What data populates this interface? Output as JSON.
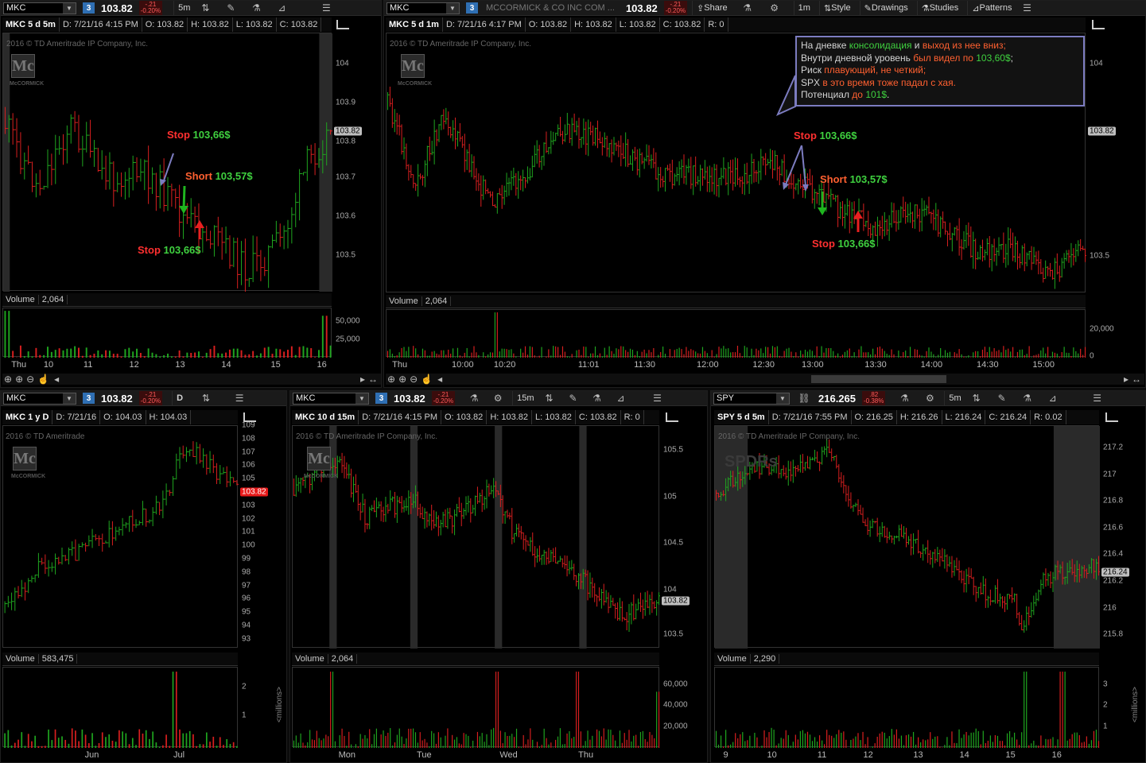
{
  "colors": {
    "up": "#1fa51f",
    "down": "#d81f1f",
    "bg": "#000000",
    "link": "#2f6fb3"
  },
  "icons": [
    "layout-icon",
    "drawings-icon",
    "studies-icon",
    "patterns-icon",
    "gear-icon",
    "style-icon",
    "share-icon",
    "menu-icon",
    "crosshair-icon",
    "zoom-in-icon",
    "zoom-out-icon",
    "zoom-icon",
    "hand-icon",
    "scroll-left-icon",
    "scroll-right-icon",
    "study-icon"
  ],
  "p1": {
    "symbol": "MKC",
    "link": "3",
    "last": "103.82",
    "chg1": "-.21",
    "chg2": "-0.20%",
    "interval": "5m",
    "title": "MKC 5 d 5m",
    "d": "D: 7/21/16 4:15 PM",
    "o": "O: 103.82",
    "h": "H: 103.82",
    "l": "L: 103.82",
    "c": "C: 103.82",
    "copyright": "2016 © TD Ameritrade IP Company, Inc.",
    "logo": "Mc",
    "logotext": "McCORMICK",
    "yticks": [
      "104",
      "103.9",
      "103.8",
      "103.7",
      "103.6",
      "103.5"
    ],
    "price_tag": "103.82",
    "vol_label": "Volume",
    "vol_val": "2,064",
    "vticks": [
      "50,000",
      "25,000"
    ],
    "xticks": [
      "Thu",
      "10",
      "11",
      "12",
      "13",
      "14",
      "15",
      "16"
    ],
    "annotations": {
      "stop1": "Stop",
      "stop1v": "103,66$",
      "short": "Short",
      "shortv": "103,57$",
      "stop2": "Stop",
      "stop2v": "103,66$"
    }
  },
  "p2": {
    "symbol": "MKC",
    "link": "3",
    "company": "MCCORMICK & CO INC COM ...",
    "last": "103.82",
    "chg1": "-.21",
    "chg2": "-0.20%",
    "share": "Share",
    "interval": "1m",
    "style": "Style",
    "drawings": "Drawings",
    "studies": "Studies",
    "patterns": "Patterns",
    "title": "MKC 5 d 1m",
    "d": "D: 7/21/16 4:17 PM",
    "o": "O: 103.82",
    "h": "H: 103.82",
    "l": "L: 103.82",
    "c": "C: 103.82",
    "r": "R: 0",
    "copyright": "2016 © TD Ameritrade IP Company, Inc.",
    "logo": "Mc",
    "logotext": "McCORMICK",
    "yticks": [
      "104",
      "103.5"
    ],
    "price_tag": "103.82",
    "vol_label": "Volume",
    "vol_val": "2,064",
    "vticks": [
      "20,000",
      "0"
    ],
    "xticks": [
      "Thu",
      "10:00",
      "10:20",
      "11:01",
      "11:30",
      "12:00",
      "12:30",
      "13:00",
      "13:30",
      "14:00",
      "14:30",
      "15:00"
    ],
    "annotations": {
      "stop1": "Stop",
      "stop1v": "103,66$",
      "short": "Short",
      "shortv": "103,57$",
      "stop2": "Stop",
      "stop2v": "103,66$"
    },
    "note": {
      "l1a": "На дневке ",
      "l1b": "консолидация",
      "l1c": " и ",
      "l1d": "выход из нее вниз;",
      "l2a": "Внутри дневной уровень ",
      "l2b": "был видел по ",
      "l2c": "103,60$",
      ";": ";",
      "l3a": "Риск ",
      "l3b": "плавующий, не четкий;",
      "l4a": "SPX ",
      "l4b": "в это время тоже падал с хая.",
      "l5a": "Потенциал ",
      "l5b": "до ",
      "l5c": "101$",
      "l5d": "."
    }
  },
  "p3": {
    "symbol": "MKC",
    "link": "3",
    "last": "103.82",
    "chg1": "-.21",
    "chg2": "-0.20%",
    "interval": "D",
    "title": "MKC 1 y D",
    "d": "D: 7/21/16",
    "o": "O: 104.03",
    "h": "H: 104.03",
    "copyright": "2016 © TD Ameritrade",
    "logo": "Mc",
    "logotext": "McCORMICK",
    "yticks": [
      "109",
      "108",
      "107",
      "106",
      "105",
      "104",
      "103",
      "102",
      "101",
      "100",
      "99",
      "98",
      "97",
      "96",
      "95",
      "94",
      "93"
    ],
    "price_tag": "103.82",
    "vol_label": "Volume",
    "vol_val": "583,475",
    "vticks": [
      "2",
      "1"
    ],
    "vunit": "<millions>",
    "xticks": [
      "Jun",
      "Jul"
    ]
  },
  "p4": {
    "symbol": "MKC",
    "link": "3",
    "last": "103.82",
    "chg1": "-.21",
    "chg2": "-0.20%",
    "interval": "15m",
    "title": "MKC 10 d 15m",
    "d": "D: 7/21/16 4:15 PM",
    "o": "O: 103.82",
    "h": "H: 103.82",
    "l": "L: 103.82",
    "c": "C: 103.82",
    "r": "R: 0",
    "copyright": "2016 © TD Ameritrade IP Company, Inc.",
    "logo": "Mc",
    "logotext": "McCORMICK",
    "yticks": [
      "105.5",
      "105",
      "104.5",
      "104",
      "103.5"
    ],
    "price_tag": "103.82",
    "vol_label": "Volume",
    "vol_val": "2,064",
    "vticks": [
      "60,000",
      "40,000",
      "20,000"
    ],
    "xticks": [
      "Mon",
      "Tue",
      "Wed",
      "Thu"
    ]
  },
  "p5": {
    "symbol": "SPY",
    "last": "216.265",
    "chg1": ".82",
    "chg2": "-0.38%",
    "interval": "5m",
    "title": "SPY 5 d 5m",
    "d": "D: 7/21/16 7:55 PM",
    "o": "O: 216.25",
    "h": "H: 216.26",
    "l": "L: 216.24",
    "c": "C: 216.24",
    "r": "R: 0.02",
    "copyright": "2016 © TD Ameritrade IP Company, Inc.",
    "logo": "SPDRs",
    "yticks": [
      "217.2",
      "217",
      "216.8",
      "216.6",
      "216.4",
      "216.2",
      "216",
      "215.8"
    ],
    "price_tag": "216.24",
    "vol_label": "Volume",
    "vol_val": "2,290",
    "vticks": [
      "3",
      "2",
      "1"
    ],
    "vunit": "<millions>",
    "xticks": [
      "9",
      "10",
      "11",
      "12",
      "13",
      "14",
      "15",
      "16"
    ]
  }
}
